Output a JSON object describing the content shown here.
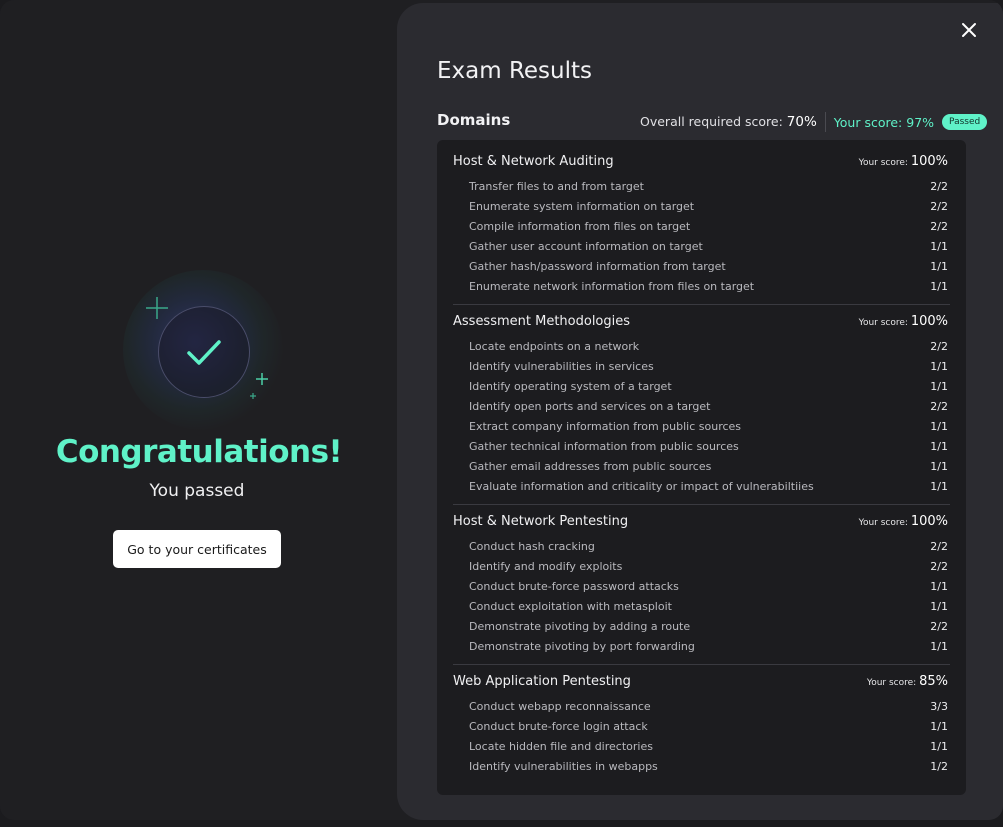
{
  "left": {
    "congrats": "Congratulations!",
    "subtitle": "You passed",
    "button": "Go to your certificates"
  },
  "right": {
    "title": "Exam Results",
    "domains_heading": "Domains",
    "overall_label": "Overall required score:",
    "overall_value": "70%",
    "your_score_label": "Your score:",
    "your_score_value": "97%",
    "status": "Passed"
  },
  "domain_score_label": "Your score:",
  "domains": [
    {
      "name": "Host & Network Auditing",
      "score": "100%",
      "items": [
        {
          "label": "Transfer files to and from target",
          "value": "2/2"
        },
        {
          "label": "Enumerate system information on target",
          "value": "2/2"
        },
        {
          "label": "Compile information from files on target",
          "value": "2/2"
        },
        {
          "label": "Gather user account information on target",
          "value": "1/1"
        },
        {
          "label": "Gather hash/password information from target",
          "value": "1/1"
        },
        {
          "label": "Enumerate network information from files on target",
          "value": "1/1"
        }
      ]
    },
    {
      "name": "Assessment Methodologies",
      "score": "100%",
      "items": [
        {
          "label": "Locate endpoints on a network",
          "value": "2/2"
        },
        {
          "label": "Identify vulnerabilities in services",
          "value": "1/1"
        },
        {
          "label": "Identify operating system of a target",
          "value": "1/1"
        },
        {
          "label": "Identify open ports and services on a target",
          "value": "2/2"
        },
        {
          "label": "Extract company information from public sources",
          "value": "1/1"
        },
        {
          "label": "Gather technical information from public sources",
          "value": "1/1"
        },
        {
          "label": "Gather email addresses from public sources",
          "value": "1/1"
        },
        {
          "label": "Evaluate information and criticality or impact of vulnerabiltiies",
          "value": "1/1"
        }
      ]
    },
    {
      "name": "Host & Network Pentesting",
      "score": "100%",
      "items": [
        {
          "label": "Conduct hash cracking",
          "value": "2/2"
        },
        {
          "label": "Identify and modify exploits",
          "value": "2/2"
        },
        {
          "label": "Conduct brute-force password attacks",
          "value": "1/1"
        },
        {
          "label": "Conduct exploitation with metasploit",
          "value": "1/1"
        },
        {
          "label": "Demonstrate pivoting by adding a route",
          "value": "2/2"
        },
        {
          "label": "Demonstrate pivoting by port forwarding",
          "value": "1/1"
        }
      ]
    },
    {
      "name": "Web Application Pentesting",
      "score": "85%",
      "items": [
        {
          "label": "Conduct webapp reconnaissance",
          "value": "3/3"
        },
        {
          "label": "Conduct brute-force login attack",
          "value": "1/1"
        },
        {
          "label": "Locate hidden file and directories",
          "value": "1/1"
        },
        {
          "label": "Identify vulnerabilities in webapps",
          "value": "1/2"
        }
      ]
    }
  ],
  "colors": {
    "accent": "#5ff2c8",
    "panel": "#1c1c1f",
    "modal": "#2b2b30"
  },
  "icons": [
    "check-icon",
    "sparkle-icon",
    "close-icon"
  ]
}
